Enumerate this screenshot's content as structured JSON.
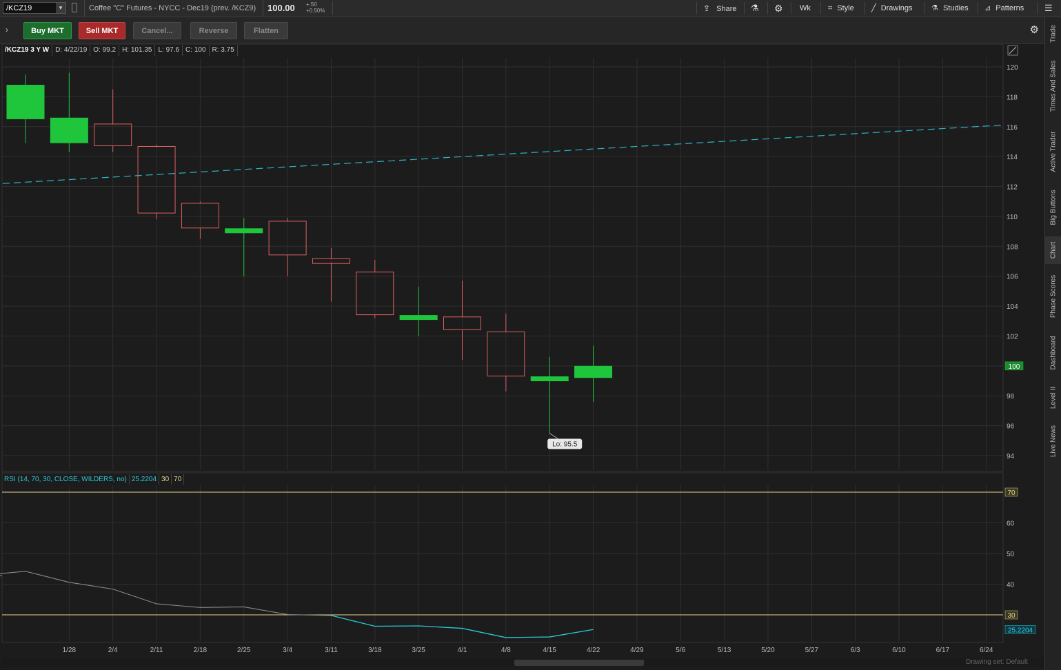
{
  "topbar": {
    "symbol": "/KCZ19",
    "description": "Coffee \"C\" Futures - NYCC - Dec19 (prev. /KCZ9)",
    "last_price": "100.00",
    "change_abs": "+.50",
    "change_pct": "+0.50%",
    "share_label": "Share",
    "aggregation_label": "Wk",
    "style_label": "Style",
    "drawings_label": "Drawings",
    "studies_label": "Studies",
    "patterns_label": "Patterns"
  },
  "orderbar": {
    "buy_label": "Buy MKT",
    "sell_label": "Sell MKT",
    "cancel_label": "Cancel...",
    "reverse_label": "Reverse",
    "flatten_label": "Flatten"
  },
  "infobar": {
    "title": "/KCZ19 3 Y W",
    "date": "D: 4/22/19",
    "open": "O: 99.2",
    "high": "H: 101.35",
    "low": "L: 97.6",
    "close": "C: 100",
    "range": "R: 3.75"
  },
  "rsi_header": {
    "label": "RSI (14, 70, 30, CLOSE, WILDERS, no)",
    "value": "25.2204",
    "oversold": "30",
    "overbought": "70"
  },
  "side_tabs": [
    "Trade",
    "Times And Sales",
    "Active Trader",
    "Big Buttons",
    "Chart",
    "Phase Scores",
    "Dashboard",
    "Level II",
    "Live News"
  ],
  "drawing_set": "Drawing set: Default",
  "colors": {
    "up": "#1fc63c",
    "down": "#e06060",
    "trendline": "#2bb5c8",
    "rsi_line": "#2bc8d8",
    "rsi_line_old": "#8a8a8a",
    "level_line": "#e8d48a",
    "grid": "#2f2f2f"
  },
  "chart_data": [
    {
      "type": "candlestick",
      "x": [
        "1/21",
        "1/28",
        "2/4",
        "2/11",
        "2/18",
        "2/25",
        "3/4",
        "3/11",
        "3/18",
        "3/25",
        "4/1",
        "4/8",
        "4/15",
        "4/22"
      ],
      "open": [
        116.5,
        114.9,
        116.2,
        114.7,
        110.9,
        109.2,
        109.7,
        107.2,
        106.3,
        103.2,
        103.3,
        102.3,
        99.0,
        99.2
      ],
      "high": [
        119.5,
        119.6,
        118.5,
        114.8,
        111.0,
        109.9,
        109.9,
        107.9,
        107.1,
        105.3,
        105.7,
        103.5,
        100.6,
        101.35
      ],
      "low": [
        114.9,
        114.3,
        114.3,
        109.8,
        108.5,
        106.0,
        106.0,
        104.3,
        103.2,
        102.0,
        100.4,
        98.3,
        95.5,
        97.6
      ],
      "close": [
        118.8,
        116.6,
        114.7,
        110.2,
        109.2,
        109.2,
        107.4,
        106.9,
        103.4,
        103.4,
        102.4,
        99.3,
        99.3,
        100.0
      ],
      "ylim": [
        93,
        121
      ],
      "yticks": [
        94,
        96,
        98,
        100,
        102,
        104,
        106,
        108,
        110,
        112,
        114,
        116,
        118,
        120
      ],
      "xticks": [
        "1/28",
        "2/4",
        "2/11",
        "2/18",
        "2/25",
        "3/4",
        "3/11",
        "3/18",
        "3/25",
        "4/1",
        "4/8",
        "4/15",
        "4/22",
        "4/29",
        "5/6",
        "5/13",
        "5/20",
        "5/27",
        "6/3",
        "6/10",
        "6/17",
        "6/24"
      ],
      "last_price_label": "100",
      "low_annotation": "Lo: 95.5",
      "trendline": {
        "x_start": "1/21",
        "y_start": 112.2,
        "x_end": "6/24",
        "y_end": 116.1
      }
    },
    {
      "type": "line",
      "title": "RSI (14, 70, 30, CLOSE, WILDERS, no)",
      "x": [
        "1/14",
        "1/21",
        "1/28",
        "2/4",
        "2/11",
        "2/18",
        "2/25",
        "3/4",
        "3/11",
        "3/18",
        "3/25",
        "4/1",
        "4/8",
        "4/15",
        "4/22"
      ],
      "values": [
        42.9,
        44.2,
        40.6,
        38.4,
        33.6,
        32.4,
        32.6,
        30.1,
        29.8,
        26.3,
        26.4,
        25.6,
        22.6,
        22.8,
        25.2204
      ],
      "ylim": [
        21,
        73
      ],
      "yticks": [
        30,
        40,
        50,
        60,
        70
      ],
      "levels": [
        30,
        70
      ],
      "last_value_label": "25.2204"
    }
  ]
}
